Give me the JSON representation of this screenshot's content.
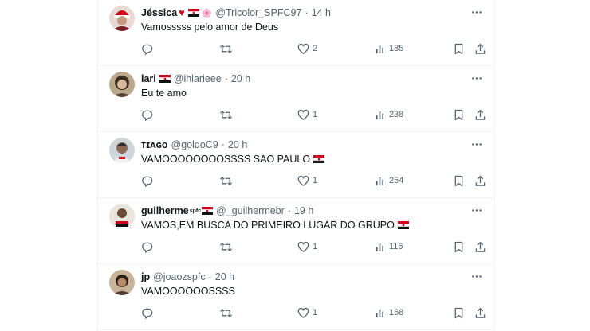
{
  "tweets": [
    {
      "name": "Jéssica",
      "name_decor": "♥",
      "name_decor2": "🌸",
      "handle": "@Tricolor_SPFC97",
      "sep": "·",
      "time": "14 h",
      "text": "Vamosssss pelo amor de Deus",
      "replies": "",
      "retweets": "",
      "likes": "2",
      "views": "185"
    },
    {
      "name": "lari",
      "handle": "@ihlarieee",
      "sep": "·",
      "time": "20 h",
      "text": "Eu te amo",
      "replies": "",
      "retweets": "",
      "likes": "1",
      "views": "238"
    },
    {
      "name": "ᴛɪᴀɢᴏ",
      "handle": "@goldoC9",
      "sep": "·",
      "time": "20 h",
      "text": "VAMOOOOOOOOSSSS SAO PAULO",
      "replies": "",
      "retweets": "",
      "likes": "1",
      "views": "254"
    },
    {
      "name": "guilherme",
      "name_small": "spfc",
      "handle": "@_guilhermebr",
      "sep": "·",
      "time": "19 h",
      "text": "VAMOS,EM BUSCA DO PRIMEIRO LUGAR DO GRUPO",
      "replies": "",
      "retweets": "",
      "likes": "1",
      "views": "116"
    },
    {
      "name": "jp",
      "handle": "@joaozspfc",
      "sep": "·",
      "time": "20 h",
      "text": "VAMOOOOOOSSSS",
      "replies": "",
      "retweets": "",
      "likes": "1",
      "views": "168"
    }
  ],
  "colors": {
    "text_primary": "#0f1419",
    "text_secondary": "#536471",
    "divider": "#eff3f4",
    "heart_red": "#e0245e",
    "flag_red": "#d0021b",
    "flag_black": "#111111"
  },
  "icons": {
    "more": "more-icon",
    "reply": "reply-icon",
    "retweet": "retweet-icon",
    "like": "heart-icon",
    "views": "views-icon",
    "bookmark": "bookmark-icon",
    "share": "share-icon",
    "flag": "spfc-flag-icon"
  }
}
